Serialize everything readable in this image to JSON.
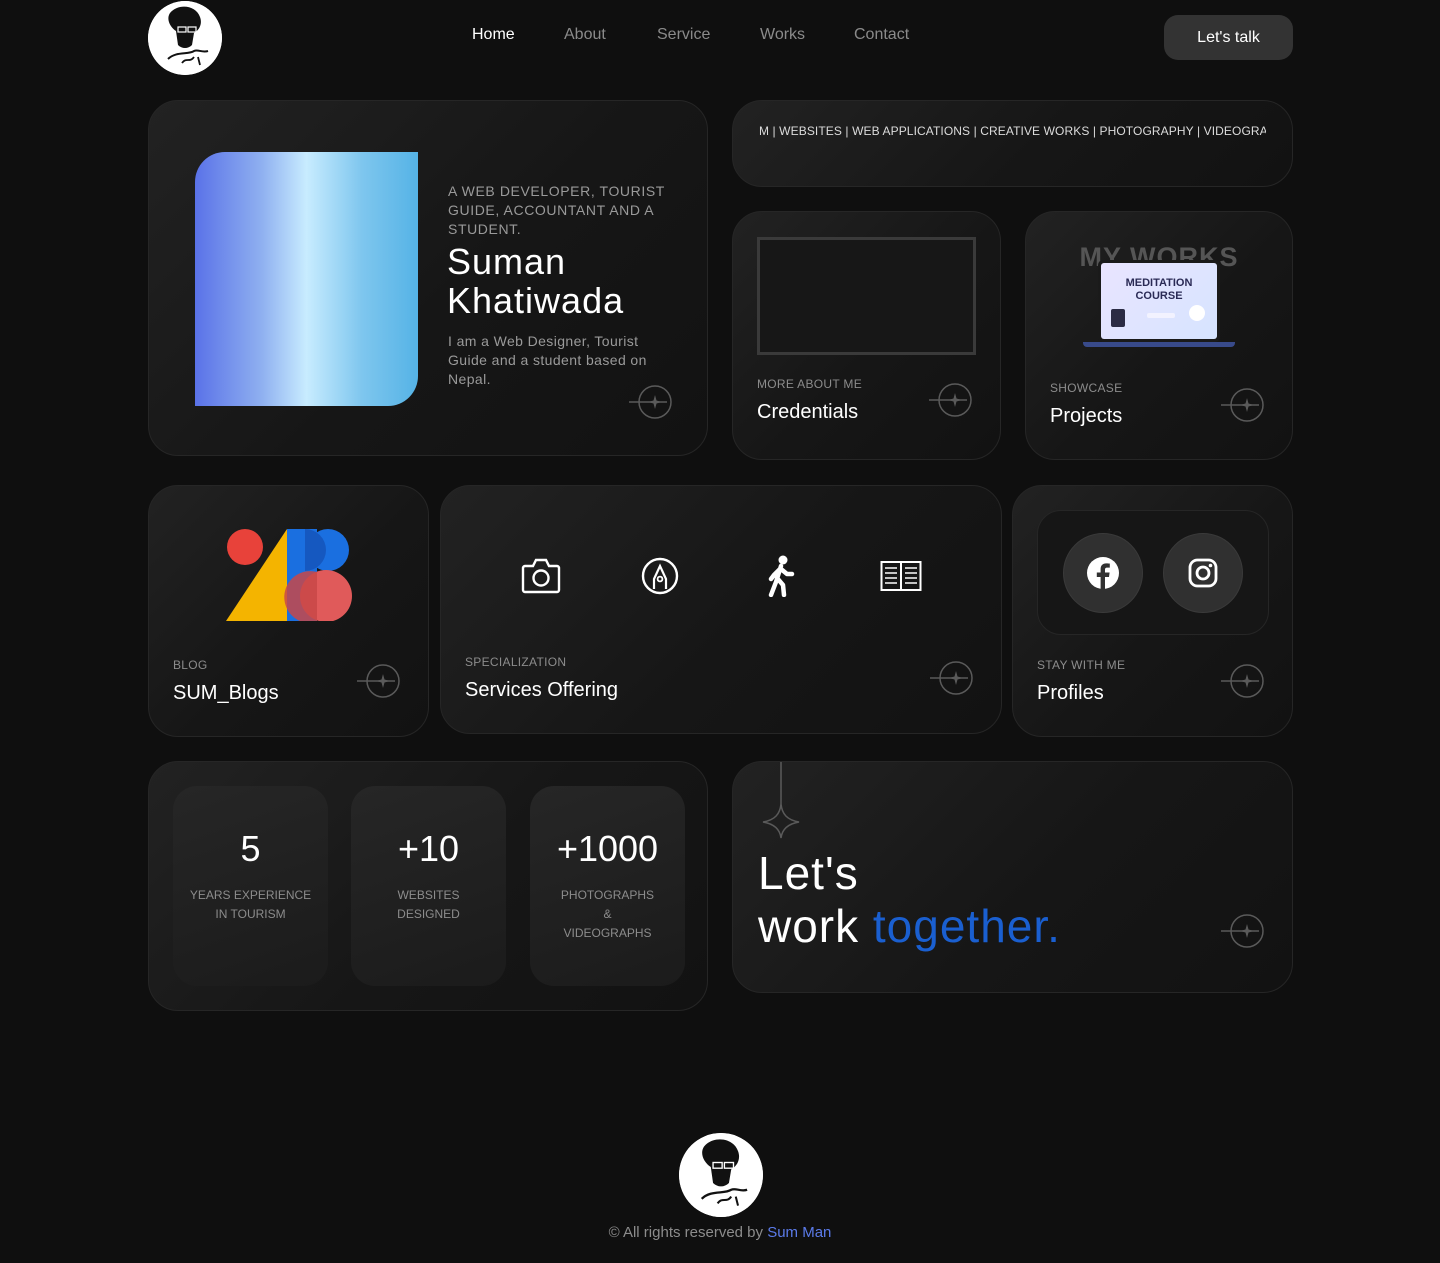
{
  "header": {
    "nav": [
      "Home",
      "About",
      "Service",
      "Works",
      "Contact"
    ],
    "cta": "Let's talk"
  },
  "hero": {
    "tagline": "A WEB DEVELOPER, TOURIST GUIDE, ACCOUNTANT AND A STUDENT.",
    "name_line1": "Suman",
    "name_line2": "Khatiwada",
    "bio": "I am a Web Designer, Tourist Guide and a student based on Nepal."
  },
  "marquee": "M | WEBSITES | WEB APPLICATIONS | CREATIVE WORKS | PHOTOGRAPHY | VIDEOGRAP",
  "credentials": {
    "eyebrow": "MORE ABOUT ME",
    "title": "Credentials"
  },
  "projects": {
    "eyebrow": "SHOWCASE",
    "title": "Projects",
    "bg_word": "MY WORKS",
    "screen_line1": "MEDITATION",
    "screen_line2": "COURSE"
  },
  "blog": {
    "eyebrow": "BLOG",
    "title": "SUM_Blogs"
  },
  "services": {
    "eyebrow": "SPECIALIZATION",
    "title": "Services Offering",
    "icons": [
      "camera-icon",
      "pen-nib-icon",
      "walking-person-icon",
      "book-icon"
    ]
  },
  "profiles": {
    "eyebrow": "STAY WITH ME",
    "title": "Profiles",
    "icons": [
      "facebook-icon",
      "instagram-icon"
    ]
  },
  "stats": [
    {
      "value": "5",
      "label": "YEARS EXPERIENCE IN TOURISM"
    },
    {
      "value": "+10",
      "label": "WEBSITES DESIGNED"
    },
    {
      "value": "+1000",
      "label": "PHOTOGRAPHS & VIDEOGRAPHS"
    }
  ],
  "cta_card": {
    "line1": "Let's",
    "line2_a": "work",
    "line2_b": "together."
  },
  "footer": {
    "prefix": "© All rights reserved by",
    "name": "Sum Man"
  },
  "colors": {
    "accent": "#1a5fd0",
    "footer_link": "#5b7bea",
    "background": "#0f0f0f"
  }
}
